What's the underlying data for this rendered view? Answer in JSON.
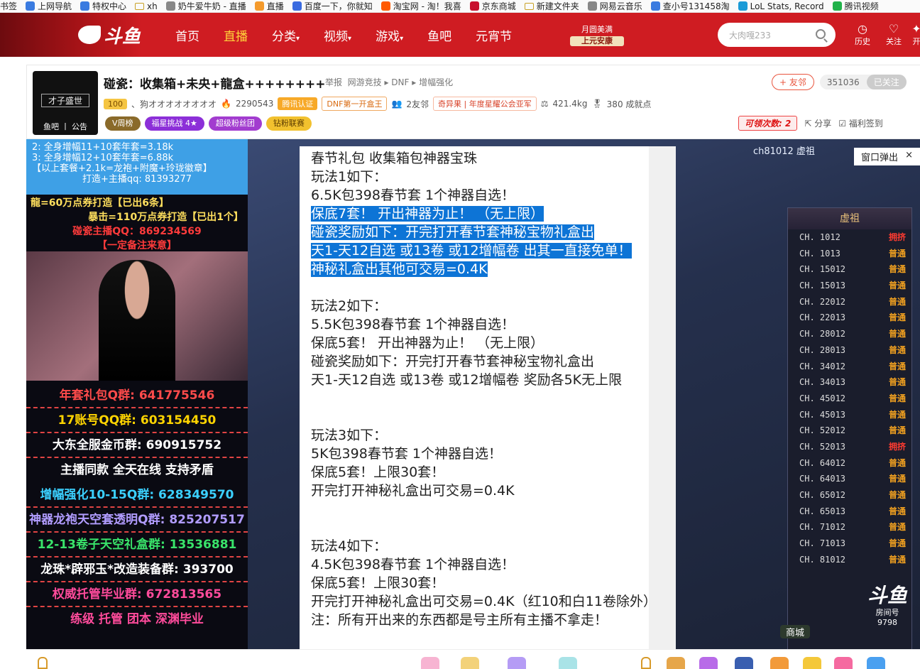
{
  "bookmarks": [
    {
      "label": "书签"
    },
    {
      "label": "上网导航"
    },
    {
      "label": "特权中心"
    },
    {
      "label": "xh"
    },
    {
      "label": "奶牛爱牛奶 - 直播"
    },
    {
      "label": "直播"
    },
    {
      "label": "百度一下，你就知"
    },
    {
      "label": "淘宝网 - 淘！我喜"
    },
    {
      "label": "京东商城"
    },
    {
      "label": "新建文件夹"
    },
    {
      "label": "网易云音乐"
    },
    {
      "label": "查小号131458淘"
    },
    {
      "label": "LoL Stats, Record"
    },
    {
      "label": "腾讯视频"
    }
  ],
  "nav": {
    "logo": "斗鱼",
    "menu": [
      "首页",
      "直播",
      "分类",
      "视频",
      "游戏",
      "鱼吧",
      "元宵节"
    ],
    "active": "直播",
    "event_line1": "月圆美满",
    "event_line2": "上元安康",
    "search_placeholder": "大肉嘎233",
    "history": "历史",
    "follow": "关注",
    "extra": "开"
  },
  "room": {
    "avatar_tag": "才子盛世",
    "avatar_footer": "鱼吧 丨 公告",
    "title": "碰瓷：收集箱+未央+龍盒++++++++",
    "report": "举报",
    "breadcrumb": "网游竞技 ▸ DNF ▸ 增幅强化",
    "level": "100",
    "owner": "、狗オオオオオオオオ",
    "heat": "2290543",
    "tencent": "腾讯认证",
    "dnf_tag": "DNF第一开盒王",
    "friends": "2友邻",
    "guild": "奇异果",
    "guild_tag": "年度星耀公会亚军",
    "weight": "421.4kg",
    "achievement": "380 成就点",
    "pill_week": "V周榜",
    "pill_star": "福星挑战",
    "pill_star_count": "4",
    "pill_fans": "超级粉丝团",
    "pill_link": "钻粉联赛",
    "friend_btn": "+ 友邻",
    "fans_count": "351036",
    "followed": "已关注",
    "rocket": "可领次数: 2",
    "share": "分享",
    "checkin": "福利签到"
  },
  "left_panel": {
    "top_lines": [
      "2: 全身增幅11+10套年套=3.18k",
      "3: 全身增幅12+10套年套=6.88k",
      "【以上套餐+2.1k=龙袍+附魔+玲珑徽章】",
      "打造+主播qq: 81393277"
    ],
    "red_lines": [
      "龍=60万点券打造【已出6条】",
      "暴击=110万点券打造【已出1个】",
      "碰瓷主播QQ：869234569",
      "【一定备注来意】"
    ],
    "groups": [
      {
        "text": "年套礼包Q群: 641775546",
        "color": "#ff4b4b"
      },
      {
        "text": "17账号QQ群: 603154450",
        "color": "#ffd400"
      },
      {
        "text": "大东全服金币群: 690915752",
        "color": "#ffffff"
      },
      {
        "text": "主播同款 全天在线 支持矛盾",
        "color": "#ffffff"
      },
      {
        "text": "增幅强化10-15Q群: 628349570",
        "color": "#3bd0ff"
      },
      {
        "text": "神器龙袍天空套透明Q群: 825207517",
        "color": "#b19cff"
      },
      {
        "text": "12-13卷子天空礼盒群: 13536881",
        "color": "#39e36a"
      },
      {
        "text": "龙珠*辟邪玉*改造装备群: 393700",
        "color": "#ffffff"
      },
      {
        "text": "权威托管毕业群: 672813565",
        "color": "#ff4b9b"
      },
      {
        "text": "练级 托管 团本 深渊毕业",
        "color": "#ff4b9b"
      }
    ]
  },
  "notice": {
    "lines": [
      {
        "t": "春节礼包 收集箱包神器宝珠",
        "hl": false
      },
      {
        "t": "玩法1如下：",
        "hl": false
      },
      {
        "t": "6.5K包398春节套 1个神器自选！",
        "hl": false
      },
      {
        "t": "保底7套！ 开出神器为止！ （无上限）",
        "hl": true
      },
      {
        "t": "碰瓷奖励如下：开完打开春节套神秘宝物礼盒出",
        "hl": true
      },
      {
        "t": "天1-天12自选 或13卷 或12增幅卷  出其一直接免单！",
        "hl": true
      },
      {
        "t": "神秘礼盒出其他可交易=0.4K",
        "hl": true
      },
      {
        "t": "",
        "hl": false
      },
      {
        "t": "玩法2如下：",
        "hl": false
      },
      {
        "t": "5.5K包398春节套 1个神器自选！",
        "hl": false
      },
      {
        "t": "保底5套！ 开出神器为止！ （无上限）",
        "hl": false
      },
      {
        "t": "碰瓷奖励如下：开完打开春节套神秘宝物礼盒出",
        "hl": false
      },
      {
        "t": "天1-天12自选 或13卷 或12增幅卷  奖励各5K无上限",
        "hl": false
      },
      {
        "t": "",
        "hl": false
      },
      {
        "t": "",
        "hl": false
      },
      {
        "t": "玩法3如下：",
        "hl": false
      },
      {
        "t": "5K包398春节套 1个神器自选！",
        "hl": false
      },
      {
        "t": "保底5套！上限30套！",
        "hl": false
      },
      {
        "t": "开完打开神秘礼盒出可交易=0.4K",
        "hl": false
      },
      {
        "t": "",
        "hl": false
      },
      {
        "t": "",
        "hl": false
      },
      {
        "t": "玩法4如下：",
        "hl": false
      },
      {
        "t": "4.5K包398春节套 1个神器自选！",
        "hl": false
      },
      {
        "t": "保底5套！上限30套！",
        "hl": false
      },
      {
        "t": "开完打开神秘礼盒出可交易=0.4K（红10和白11卷除外）",
        "hl": false
      },
      {
        "t": "注：所有开出来的东西都是号主所有主播不拿走！",
        "hl": false
      }
    ]
  },
  "popout": "窗口弹出",
  "server_list": {
    "channel": "ch81012 虚祖",
    "header": "虚祖",
    "items": [
      {
        "ch": "CH. 1012",
        "status": "拥挤"
      },
      {
        "ch": "CH. 1013",
        "status": "普通"
      },
      {
        "ch": "CH. 15012",
        "status": "普通"
      },
      {
        "ch": "CH. 15013",
        "status": "普通"
      },
      {
        "ch": "CH. 22012",
        "status": "普通"
      },
      {
        "ch": "CH. 22013",
        "status": "普通"
      },
      {
        "ch": "CH. 28012",
        "status": "普通"
      },
      {
        "ch": "CH. 28013",
        "status": "普通"
      },
      {
        "ch": "CH. 34012",
        "status": "普通"
      },
      {
        "ch": "CH. 34013",
        "status": "普通"
      },
      {
        "ch": "CH. 45012",
        "status": "普通"
      },
      {
        "ch": "CH. 45013",
        "status": "普通"
      },
      {
        "ch": "CH. 52012",
        "status": "普通"
      },
      {
        "ch": "CH. 52013",
        "status": "拥挤"
      },
      {
        "ch": "CH. 64012",
        "status": "普通"
      },
      {
        "ch": "CH. 64013",
        "status": "普通"
      },
      {
        "ch": "CH. 65012",
        "status": "普通"
      },
      {
        "ch": "CH. 65013",
        "status": "普通"
      },
      {
        "ch": "CH. 71012",
        "status": "普通"
      },
      {
        "ch": "CH. 71013",
        "status": "普通"
      },
      {
        "ch": "CH. 81012",
        "status": "普通"
      }
    ]
  },
  "watermark": {
    "brand": "斗鱼",
    "label": "房间号",
    "room": "9798"
  },
  "shop": "商城",
  "colors": {
    "brand_red": "#cf1c22",
    "highlight": "#0d74d6"
  }
}
